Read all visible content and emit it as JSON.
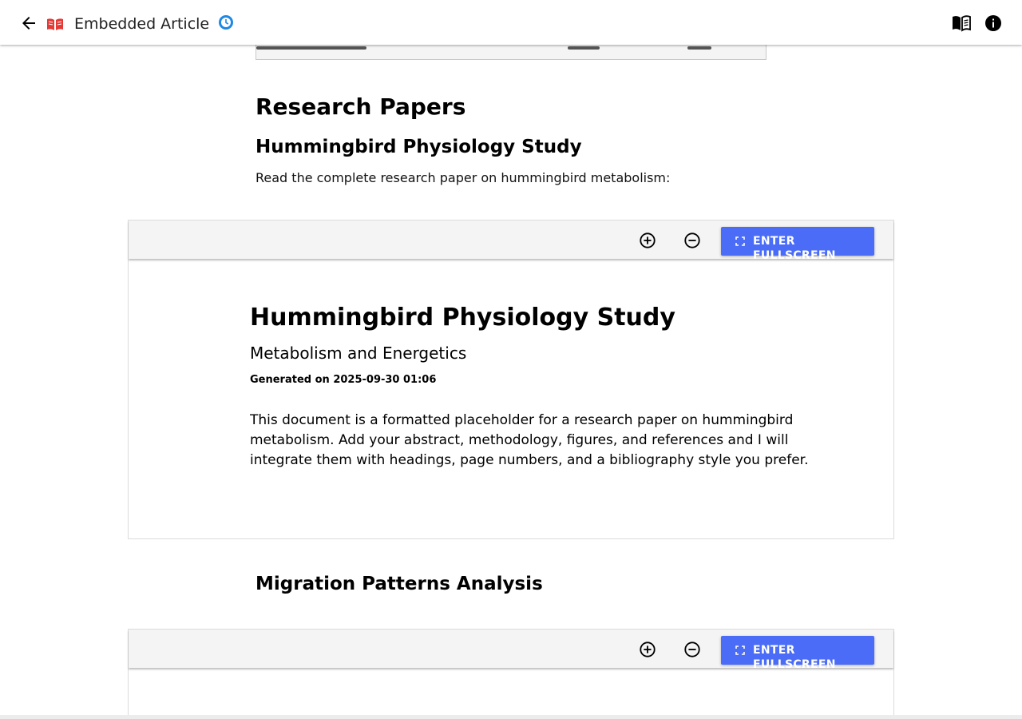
{
  "app_bar": {
    "title": "Embedded Article",
    "colors": {
      "logo": "#e53935",
      "sync": "#1e88e5"
    }
  },
  "content": {
    "section_heading": "Research Papers",
    "paper1": {
      "heading": "Hummingbird Physiology Study",
      "intro": "Read the complete research paper on hummingbird metabolism:"
    },
    "paper2": {
      "heading": "Migration Patterns Analysis"
    }
  },
  "viewer": {
    "fullscreen_label": "ENTER FULLSCREEN",
    "button_color": "#4a6cf7",
    "document": {
      "title": "Hummingbird Physiology Study",
      "subtitle": "Metabolism and Energetics",
      "generated": "Generated on 2025-09-30 01:06",
      "body_lines": [
        "This document is a formatted placeholder for a research paper on hummingbird",
        "metabolism. Add your abstract, methodology, figures, and references and I will",
        "integrate them with headings, page numbers, and a bibliography style you prefer."
      ]
    }
  }
}
